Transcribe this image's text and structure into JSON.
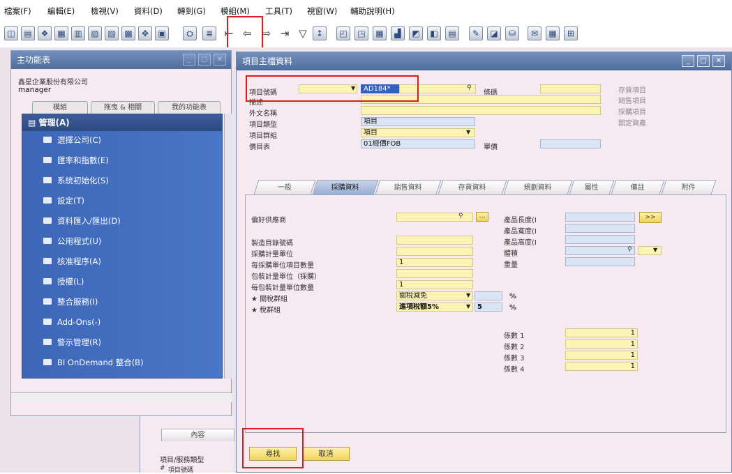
{
  "menubar": [
    "檔案(F)",
    "編輯(E)",
    "檢視(V)",
    "資料(D)",
    "轉到(G)",
    "模組(M)",
    "工具(T)",
    "視窗(W)",
    "輔助說明(H)"
  ],
  "toolbar": [
    "preview-icon",
    "print-icon",
    "tree-icon",
    "export-icon",
    "printer-icon",
    "doc-icon",
    "doc2-icon",
    "doc3-icon",
    "move-icon",
    "form-icon",
    "find-icon",
    "list-icon",
    "first-record-icon",
    "prev-record-icon",
    "next-record-icon",
    "last-record-icon",
    "filter-icon",
    "sort-icon",
    "base-doc-icon",
    "target-doc-icon",
    "table-icon",
    "chart-icon",
    "analysis-icon",
    "report-icon",
    "calc-icon",
    "settings-icon",
    "lock-icon",
    "db-icon",
    "mail-icon",
    "calendar-icon",
    "network-icon"
  ],
  "main_menu": {
    "title": "主功能表",
    "company": "鑫星企業股份有限公司",
    "user": "manager",
    "tabs": [
      "模組",
      "拖曳 & 相關",
      "我的功能表"
    ],
    "header": "管理(A)",
    "items": [
      "選擇公司(C)",
      "匯率和指數(E)",
      "系統初始化(S)",
      "設定(T)",
      "資料匯入/匯出(D)",
      "公用程式(U)",
      "核准程序(A)",
      "授權(L)",
      "整合服務(I)",
      "Add-Ons(-)",
      "警示管理(R)",
      "BI OnDemand 整合(B)"
    ]
  },
  "lower_panel": {
    "tab": "內容",
    "label": "項目/服務類型",
    "row_hash": "#",
    "row_label": "項目號碼"
  },
  "item_master": {
    "title": "項目主檔資料",
    "labels": {
      "item_no": "項目號碼",
      "desc": "描述",
      "foreign_name": "外文名稱",
      "item_type": "項目類型",
      "item_group": "項目群組",
      "price_list": "價目表",
      "barcode": "條碼",
      "unit_price": "單價"
    },
    "values": {
      "item_no": "AD184*",
      "item_type": "項目",
      "item_group": "項目",
      "price_list": "01經價FOB"
    },
    "flags": [
      "存貨項目",
      "銷售項目",
      "採購項目",
      "固定資產"
    ],
    "tabs": [
      "一般",
      "採購資料",
      "銷售資料",
      "存貨資料",
      "規劃資料",
      "屬性",
      "備註",
      "附件"
    ],
    "purchasing": {
      "labels": [
        "偏好供應商",
        "製造目錄號碼",
        "採購計量單位",
        "每採購單位項目數量",
        "包裝計量單位（採購）",
        "每包裝計量單位數量",
        "★ 關稅群組",
        "★ 稅群組"
      ],
      "qty_per_unit": "1",
      "qty_per_pkg": "1",
      "customs_group": "關稅減免",
      "tax_group": "進項稅額5%",
      "tax_rate": "5",
      "pct": "%",
      "dims": [
        "產品長度(I",
        "產品寬度(I",
        "產品高度(I",
        "體積",
        "重量"
      ],
      "more_btn": ">>",
      "factors": [
        {
          "label": "係數 1",
          "value": "1"
        },
        {
          "label": "係數 2",
          "value": "1"
        },
        {
          "label": "係數 3",
          "value": "1"
        },
        {
          "label": "係數 4",
          "value": "1"
        }
      ]
    },
    "buttons": {
      "find": "尋找",
      "cancel": "取消"
    }
  }
}
